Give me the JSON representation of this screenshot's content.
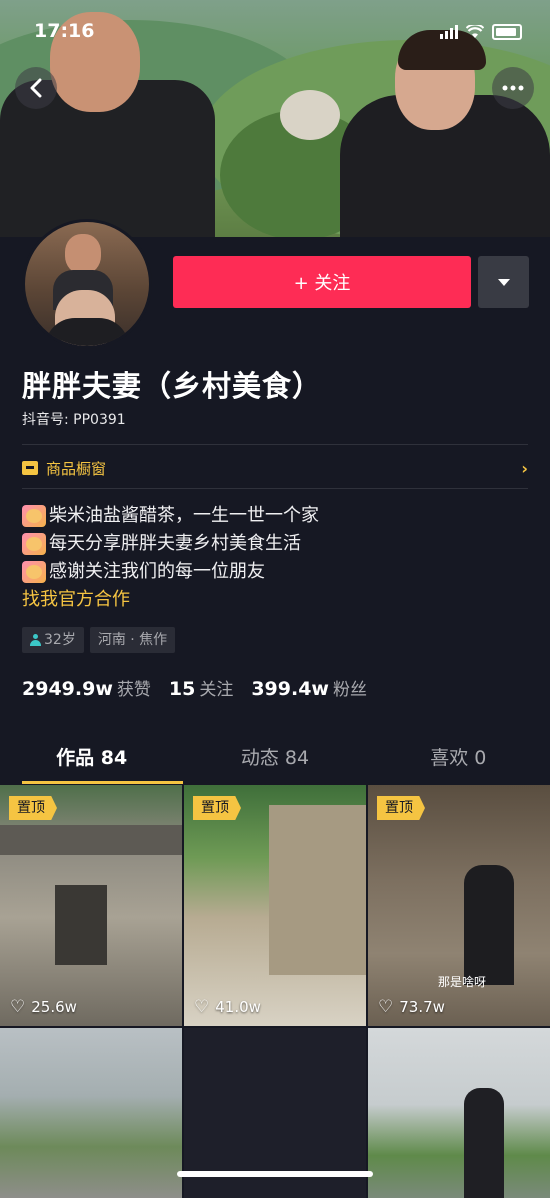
{
  "status_bar": {
    "time": "17:16"
  },
  "header": {
    "back_icon": "chevron-left-icon",
    "more_icon": "more-dots-icon"
  },
  "actions": {
    "follow_label": "+ 关注",
    "dropdown_icon": "caret-down-icon"
  },
  "profile": {
    "name": "胖胖夫妻（乡村美食）",
    "douyin_id": "抖音号: PP0391",
    "shop_label": "商品橱窗",
    "bio": [
      "柴米油盐酱醋茶，一生一世一个家",
      "每天分享胖胖夫妻乡村美食生活",
      "感谢关注我们的每一位朋友"
    ],
    "cooperation_link": "找我官方合作",
    "tags": {
      "age": "32岁",
      "location": "河南 · 焦作"
    },
    "stats": {
      "likes_value": "2949.9w",
      "likes_label": "获赞",
      "following_value": "15",
      "following_label": "关注",
      "followers_value": "399.4w",
      "followers_label": "粉丝"
    }
  },
  "tabs": [
    {
      "label": "作品 84",
      "active": true
    },
    {
      "label": "动态 84",
      "active": false
    },
    {
      "label": "喜欢 0",
      "active": false
    }
  ],
  "videos": [
    {
      "pinned": "置顶",
      "likes": "25.6w",
      "caption": ""
    },
    {
      "pinned": "置顶",
      "likes": "41.0w",
      "caption": ""
    },
    {
      "pinned": "置顶",
      "likes": "73.7w",
      "caption": "那是啥呀"
    },
    {
      "pinned": "",
      "likes": "",
      "caption": ""
    },
    {
      "pinned": "",
      "likes": "",
      "caption": ""
    },
    {
      "pinned": "",
      "likes": "",
      "caption": ""
    }
  ],
  "colors": {
    "accent": "#fe2c55",
    "gold": "#f5c442",
    "background": "#161823"
  }
}
